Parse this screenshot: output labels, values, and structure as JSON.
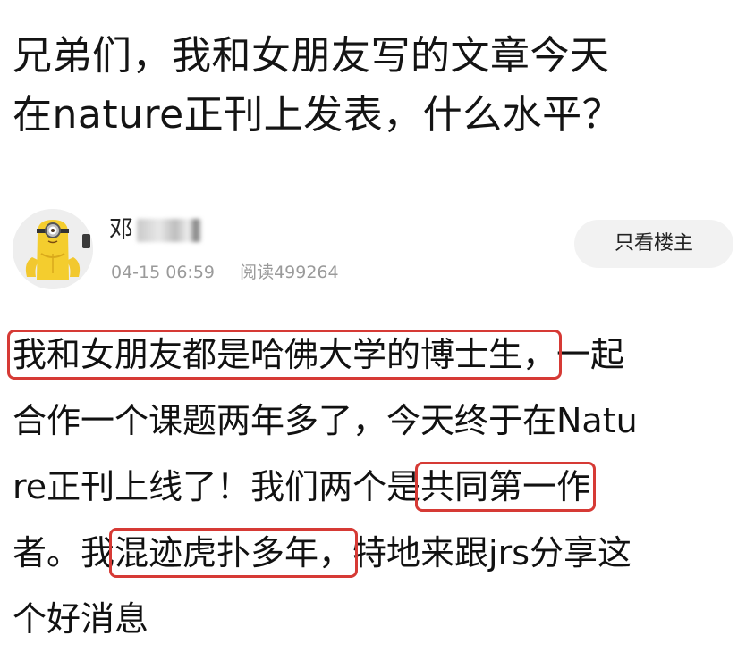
{
  "post": {
    "title_line1": "兄弟们，我和女朋友写的文章今天",
    "title_line2": "在nature正刊上发表，什么水平？"
  },
  "author": {
    "name_visible": "邓",
    "name_obscured": true,
    "date": "04-15 06:59",
    "read_label": "阅读499264",
    "avatar_icon": "minion-avatar",
    "only_op_button": "只看楼主"
  },
  "content": {
    "l1_highlight": "我和女朋友都是哈佛大学的博士生，",
    "l1_rest": "一起",
    "l2": "合作一个课题两年多了，今天终于在Natu",
    "l3_pre": "re正刊上线了！我们两个是",
    "l3_highlight": "共同第一作",
    "l4_pre": "者。我",
    "l4_highlight": "混迹虎扑多年，",
    "l4_rest": "特地来跟jrs分享这",
    "l5": "个好消息"
  },
  "colors": {
    "highlight_box": "#d63a35",
    "meta_text": "#9a9a9a",
    "button_bg": "#f2f2f2"
  }
}
